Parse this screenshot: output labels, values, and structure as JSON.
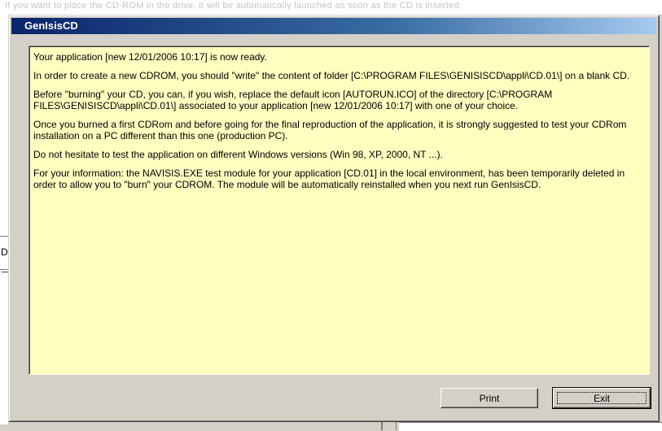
{
  "background": {
    "top_text": "If you want to place the CD-ROM in the drive, it will be automatically launched as soon as the CD is inserted",
    "left_letter": "D"
  },
  "dialog": {
    "title": "GenIsisCD",
    "paragraphs": [
      "Your application [new 12/01/2006 10:17] is now ready.",
      "In order to create a new CDROM, you should \"write\" the content of folder [C:\\PROGRAM FILES\\GENISISCD\\appli\\CD.01\\] on a blank CD.",
      "Before \"burning\" your CD, you can, if you wish, replace the default icon [AUTORUN.ICO] of the directory [C:\\PROGRAM FILES\\GENISISCD\\appli\\CD.01\\] associated to your application [new 12/01/2006 10:17] with one of your choice.",
      "Once you burned a first CDRom and before going for the final reproduction of the application, it is strongly suggested to test your CDRom installation on a PC different than this one (production PC).",
      "Do not hesitate to test the application on different Windows versions (Win 98, XP, 2000, NT ...).",
      "For your information: the NAVISIS.EXE test module for your application [CD.01] in the local environment, has been temporarily deleted in order to allow you to \"burn\" your CDROM. The module will be automatically reinstalled when you next run GenIsisCD."
    ],
    "buttons": {
      "print": "Print",
      "exit": "Exit"
    }
  },
  "colors": {
    "titlebar_start": "#0a246a",
    "titlebar_end": "#a6caf0",
    "content_bg": "#ffffc0",
    "face": "#d4d0c8"
  }
}
